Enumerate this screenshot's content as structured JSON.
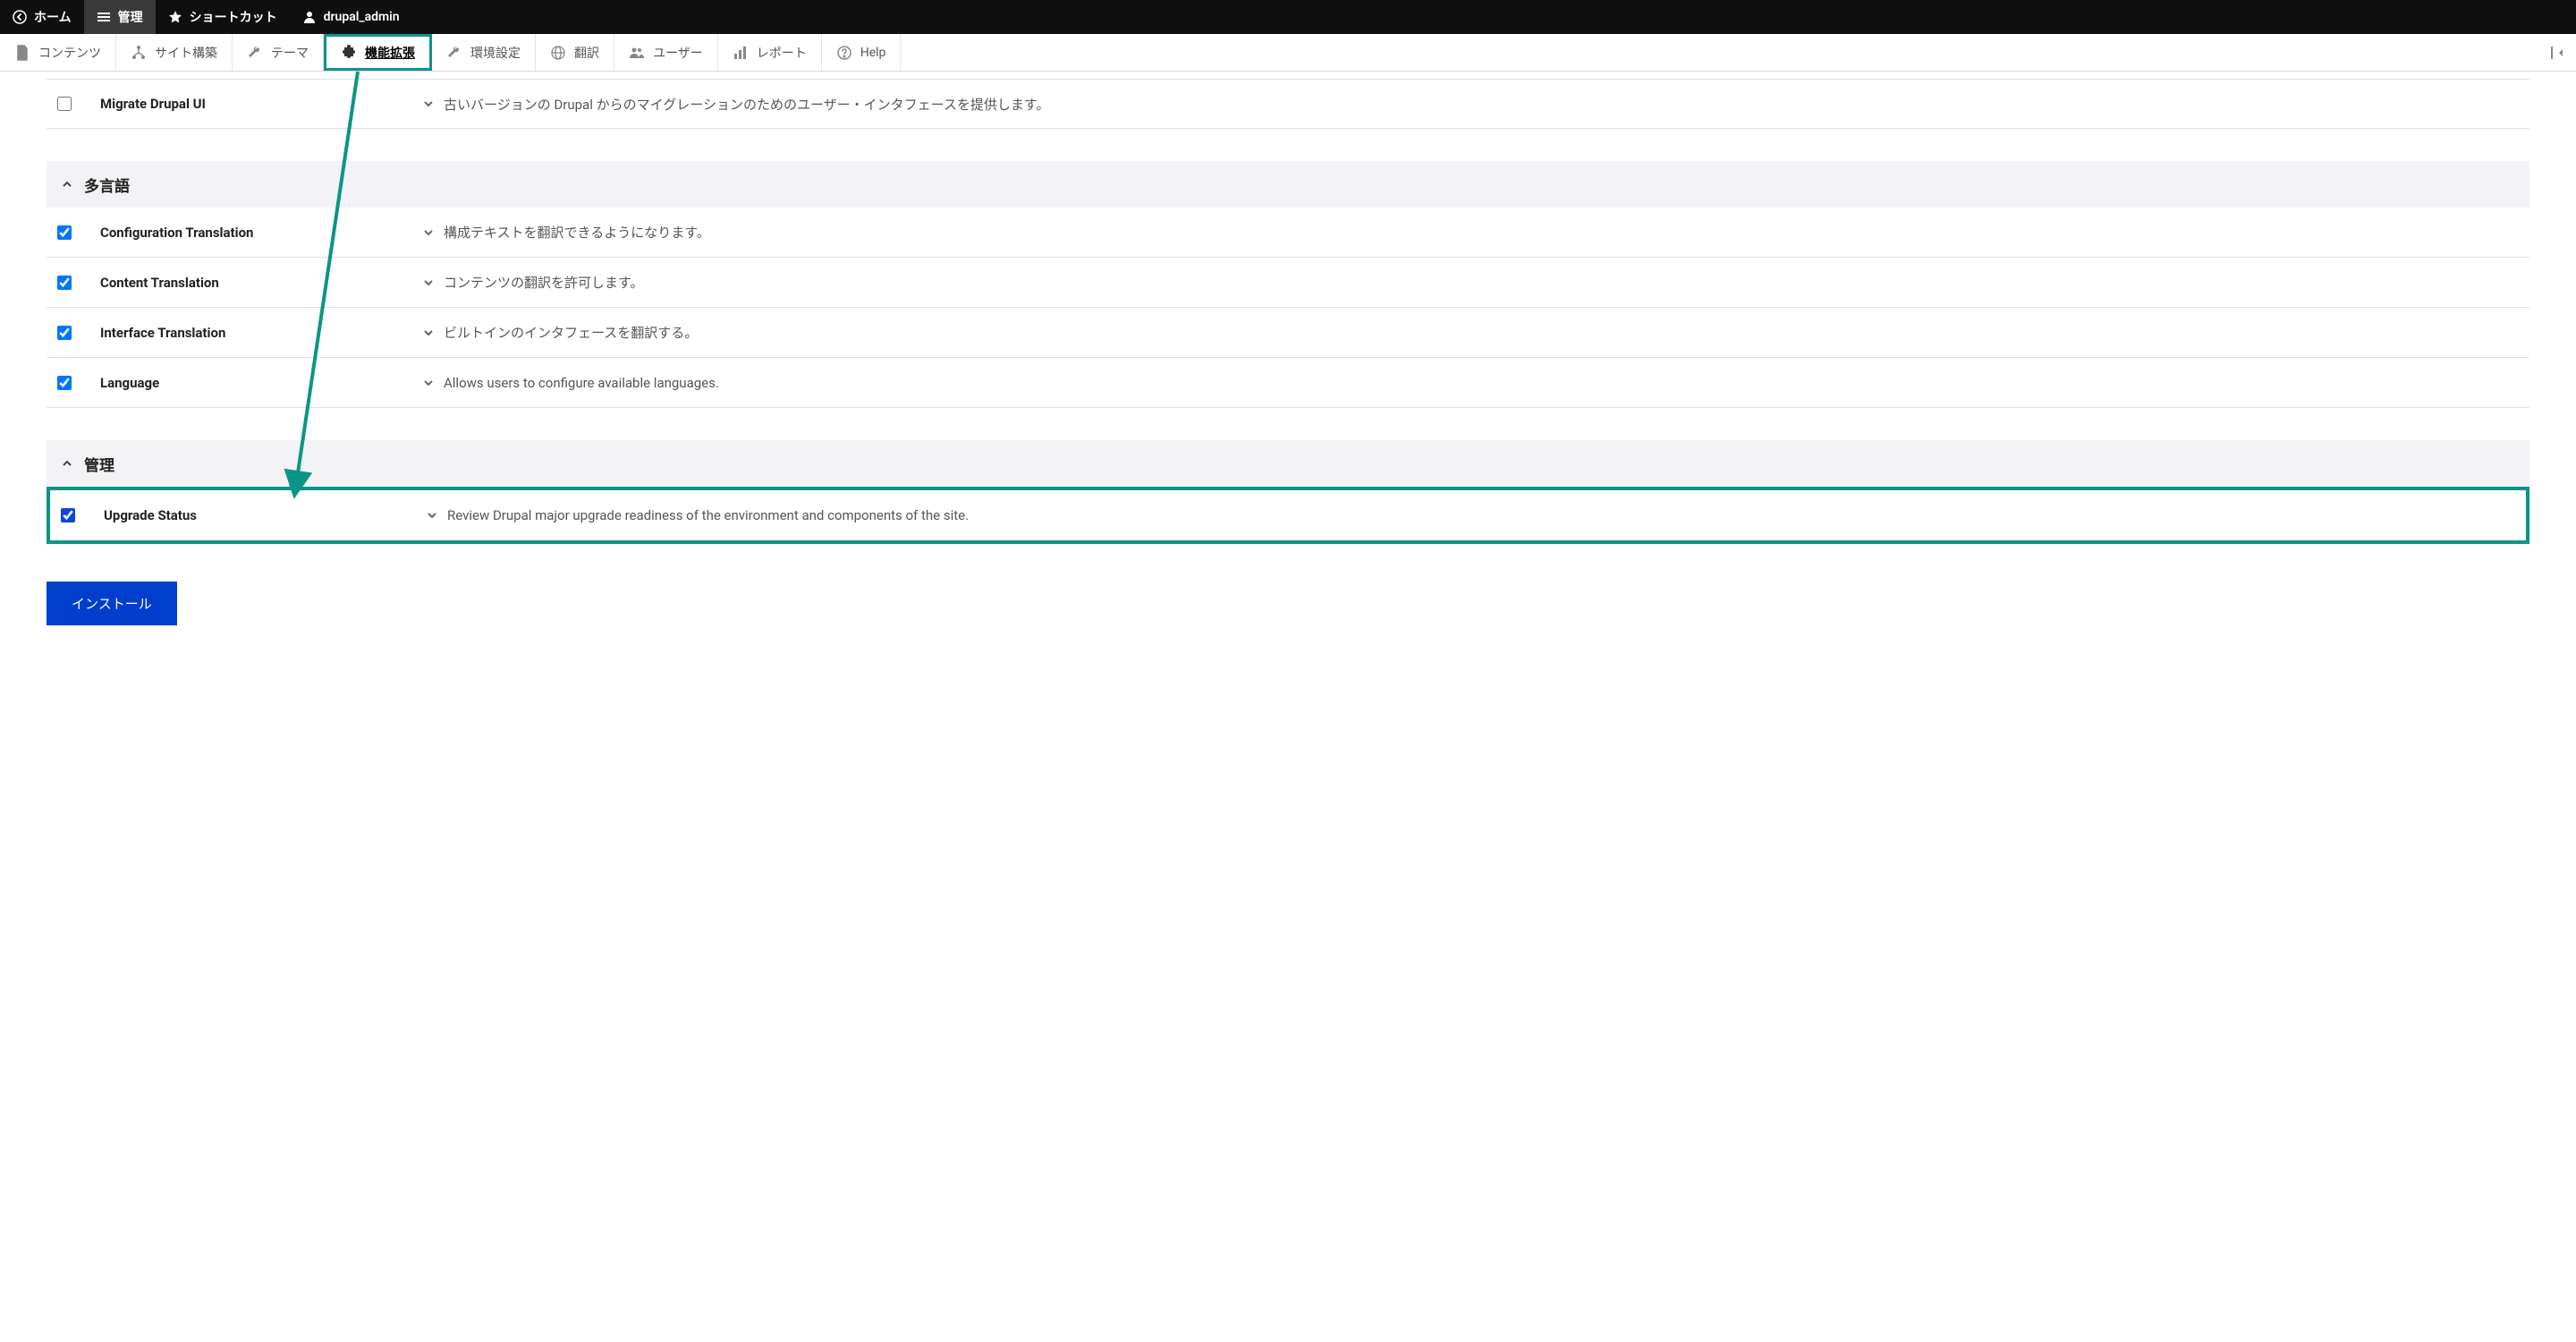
{
  "top_toolbar": {
    "home": "ホーム",
    "manage": "管理",
    "shortcuts": "ショートカット",
    "user": "drupal_admin"
  },
  "admin_menu": {
    "content": "コンテンツ",
    "structure": "サイト構築",
    "appearance": "テーマ",
    "extend": "機能拡張",
    "configuration": "環境設定",
    "translation": "翻訳",
    "people": "ユーザー",
    "reports": "レポート",
    "help": "Help"
  },
  "modules": {
    "migrate_ui": {
      "name": "Migrate Drupal UI",
      "desc": "古いバージョンの Drupal からのマイグレーションのためのユーザー・インタフェースを提供します。"
    }
  },
  "sections": {
    "multilingual": {
      "title": "多言語",
      "items": [
        {
          "name": "Configuration Translation",
          "desc": "構成テキストを翻訳できるようになります。"
        },
        {
          "name": "Content Translation",
          "desc": "コンテンツの翻訳を許可します。"
        },
        {
          "name": "Interface Translation",
          "desc": "ビルトインのインタフェースを翻訳する。"
        },
        {
          "name": "Language",
          "desc": "Allows users to configure available languages."
        }
      ]
    },
    "admin": {
      "title": "管理",
      "items": [
        {
          "name": "Upgrade Status",
          "desc": "Review Drupal major upgrade readiness of the environment and components of the site."
        }
      ]
    }
  },
  "buttons": {
    "install": "インストール"
  }
}
